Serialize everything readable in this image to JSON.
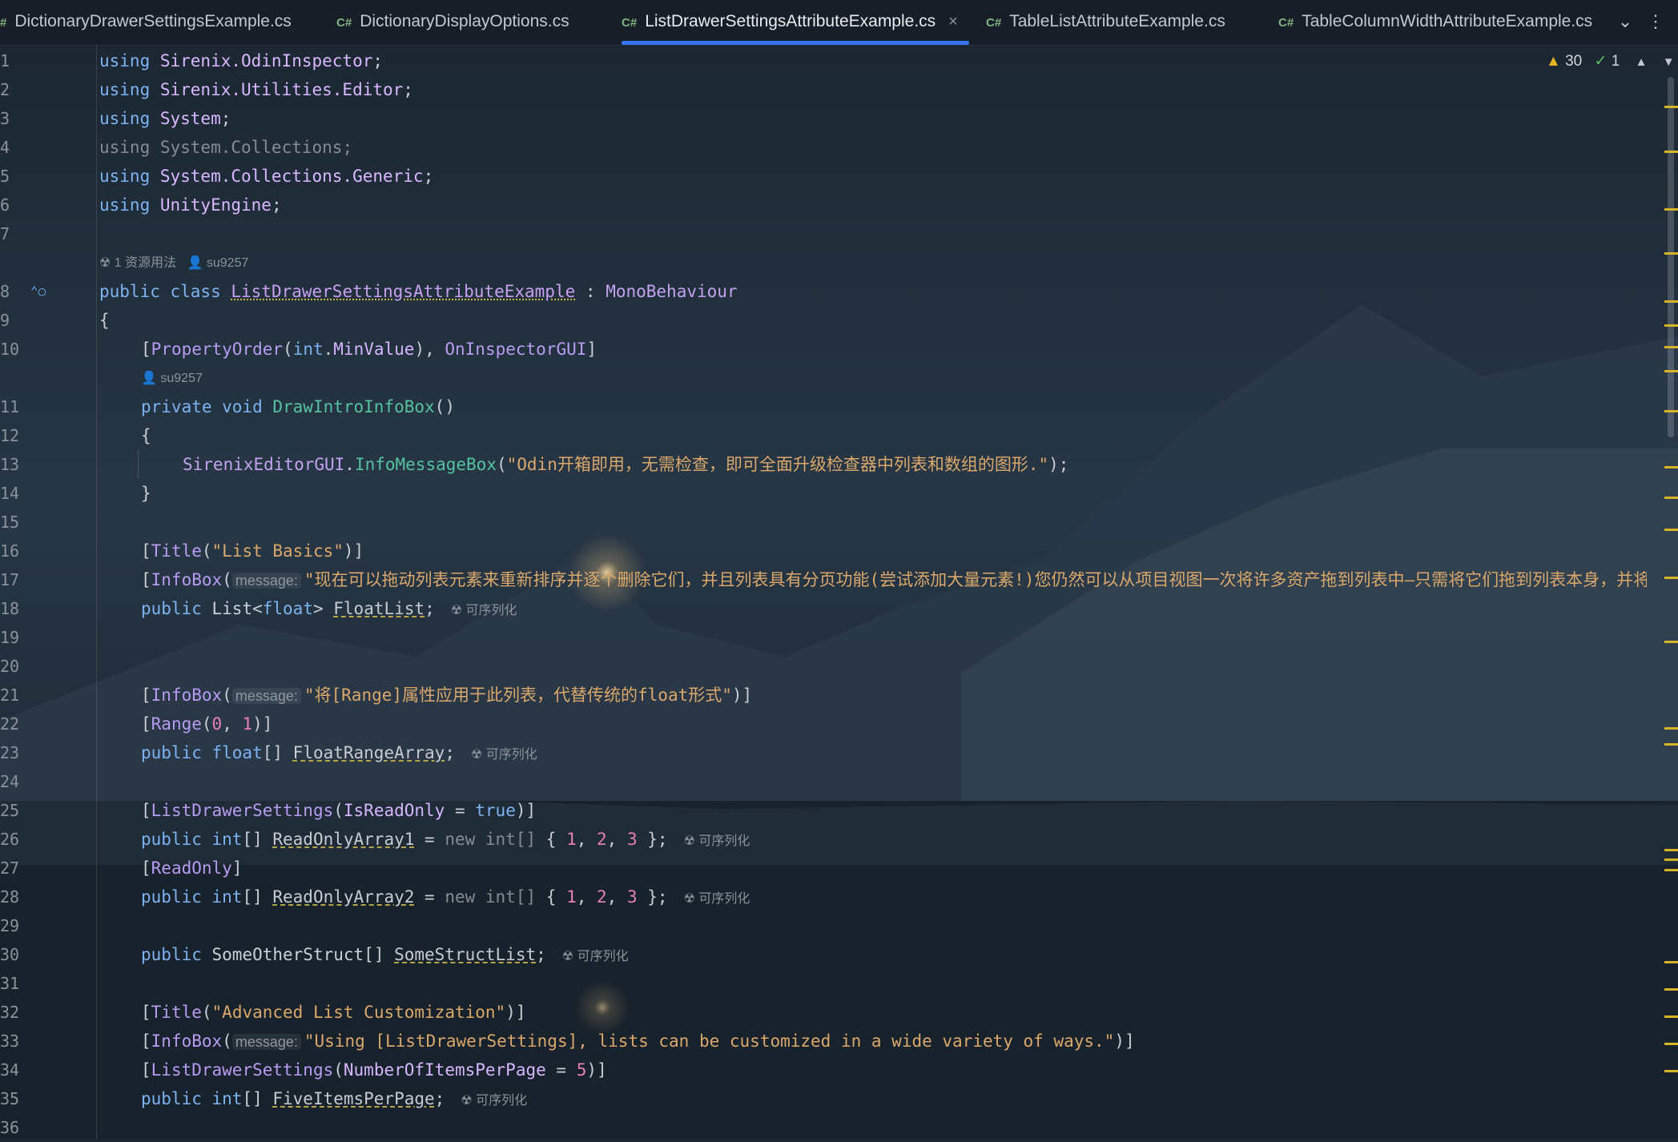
{
  "tabs": [
    {
      "prefix": "#",
      "label": "DictionaryDrawerSettingsExample.cs"
    },
    {
      "prefix": "C#",
      "label": "DictionaryDisplayOptions.cs"
    },
    {
      "prefix": "C#",
      "label": "ListDrawerSettingsAttributeExample.cs",
      "active": true
    },
    {
      "prefix": "C#",
      "label": "TableListAttributeExample.cs"
    },
    {
      "prefix": "C#",
      "label": "TableColumnWidthAttributeExample.cs"
    }
  ],
  "tab_close_glyph": "×",
  "tab_menu_glyph": "⌄",
  "more_glyph": "⋮",
  "inspection": {
    "warnings": "30",
    "ok": "1"
  },
  "hints": {
    "class_usage": "1 资源用法",
    "author": "su9257",
    "serializable": "可序列化"
  },
  "line_numbers": [
    "1",
    "2",
    "3",
    "4",
    "5",
    "6",
    "7",
    "8",
    "9",
    "10",
    "11",
    "12",
    "13",
    "14",
    "15",
    "16",
    "17",
    "18",
    "19",
    "20",
    "21",
    "22",
    "23",
    "24",
    "25",
    "26",
    "27",
    "28",
    "29",
    "30",
    "31",
    "32",
    "33",
    "34",
    "35",
    "36"
  ],
  "code": {
    "l1": "Sirenix.OdinInspector",
    "l2": "Sirenix.Utilities.Editor",
    "l3": "System",
    "l4": "System.Collections",
    "l5": "System.Collections.Generic",
    "l6": "UnityEngine",
    "class_name": "ListDrawerSettingsAttributeExample",
    "base_class": "MonoBehaviour",
    "l10_attr": "PropertyOrder",
    "l10_type": "int",
    "l10_member": "MinValue",
    "l10_attr2": "OnInspectorGUI",
    "method_name": "DrawIntroInfoBox",
    "l13_class": "SirenixEditorGUI",
    "l13_method": "InfoMessageBox",
    "l13_str": "\"Odin开箱即用，无需检查，即可全面升级检查器中列表和数组的图形.\"",
    "l16_str": "\"List Basics\"",
    "param_message": "message:",
    "l17_str": "\"现在可以拖动列表元素来重新排序并逐个删除它们，并且列表具有分页功能(尝试添加大量元素!)您仍然可以从项目视图一次将许多资产拖到列表中—只需将它们拖到列表本身，并将它",
    "l18_field": "FloatList",
    "l21_str": "\"将[Range]属性应用于此列表，代替传统的float形式\"",
    "l23_field": "FloatRangeArray",
    "l25_attr": "ListDrawerSettings",
    "l25_prop": "IsReadOnly",
    "l26_field": "ReadOnlyArray1",
    "l27_attr": "ReadOnly",
    "l28_field": "ReadOnlyArray2",
    "l30_type": "SomeOtherStruct",
    "l30_field": "SomeStructList",
    "l32_str": "\"Advanced List Customization\"",
    "l33_str": "\"Using [ListDrawerSettings], lists can be customized in a wide variety of ways.\"",
    "l34_prop": "NumberOfItemsPerPage",
    "l35_field": "FiveItemsPerPage"
  },
  "colors": {
    "accent": "#3574f0",
    "warning": "#e6b422",
    "ok": "#5fb865"
  }
}
